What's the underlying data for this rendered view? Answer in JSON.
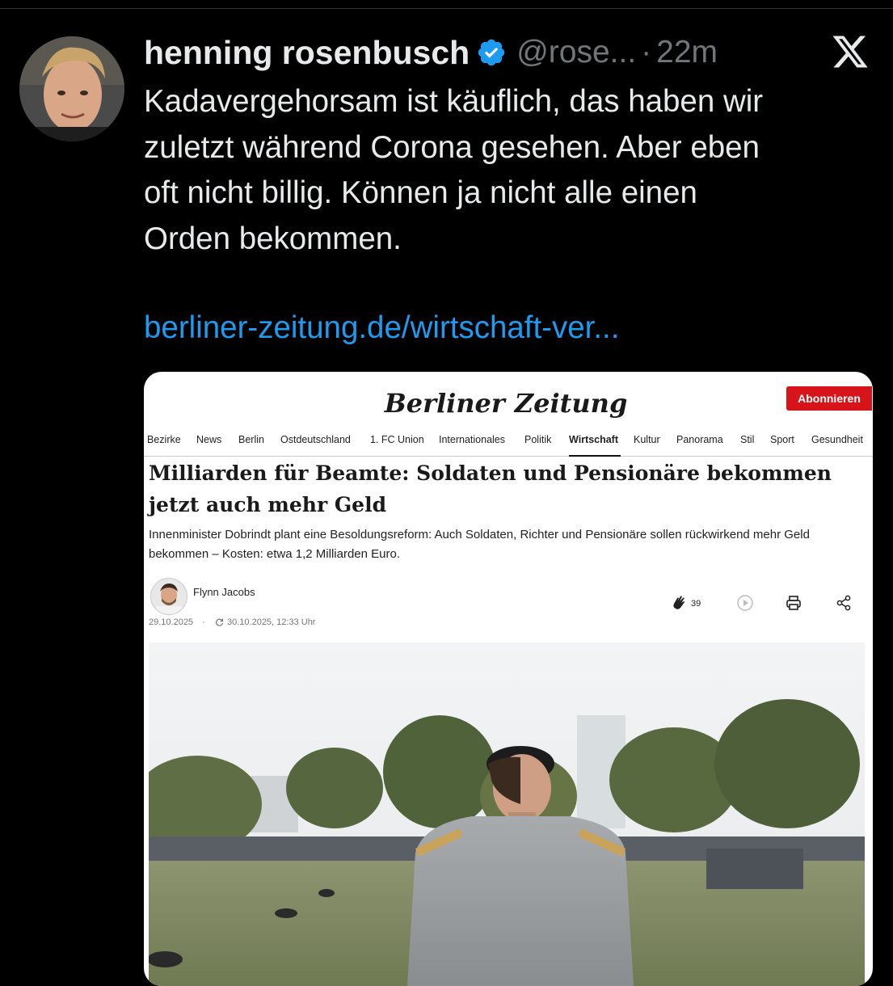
{
  "tweet": {
    "display_name": "henning rosenbusch",
    "handle": "@rose...",
    "separator": "·",
    "time": "22m",
    "text": "Kadavergehorsam ist käuflich, das haben wir\nzuletzt während Corona gesehen. Aber eben\noft nicht billig. Können ja nicht alle einen\nOrden bekommen.",
    "link": "berliner-zeitung.de/wirtschaft-ver...",
    "icons": [
      "verified-badge-icon",
      "x-logo-icon"
    ],
    "colors": {
      "link": "#1d9bf0",
      "verified": "#1d9bf0",
      "background": "#000000"
    }
  },
  "card": {
    "logo_text_1": "Berliner",
    "logo_text_2": "Zeitung",
    "subscribe_label": "Abonnieren",
    "nav": [
      "Bezirke",
      "News",
      "Berlin",
      "Ostdeutschland",
      "1. FC Union",
      "Internationales",
      "Politik",
      "Wirtschaft",
      "Kultur",
      "Panorama",
      "Stil",
      "Sport",
      "Gesundheit"
    ],
    "active_nav": "Wirtschaft",
    "headline": "Milliarden für Beamte: Soldaten und Pensionäre bekommen jetzt auch mehr Geld",
    "lead": "Innenminister Dobrindt plant eine Besoldungsreform: Auch Soldaten, Richter und Pensionäre sollen rückwirkend mehr Geld bekommen – Kosten: etwa 1,2 Milliarden Euro.",
    "author": "Flynn Jacobs",
    "date": "29.10.2025",
    "date_separator": "·",
    "updated": "30.10.2025, 12:33 Uhr",
    "clap_count": "39",
    "action_icons": [
      "clap-icon",
      "play-icon",
      "print-icon",
      "share-icon"
    ],
    "colors": {
      "subscribe": "#d7141a"
    }
  }
}
